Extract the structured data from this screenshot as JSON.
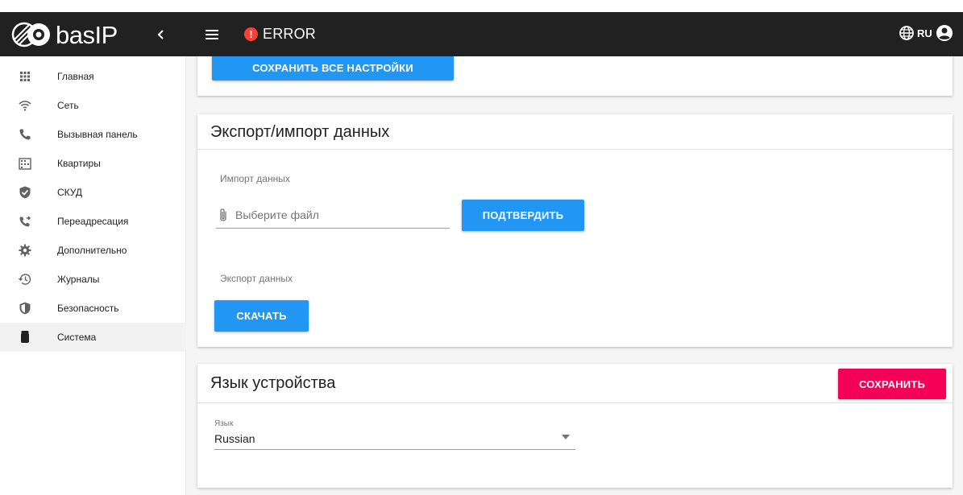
{
  "header": {
    "logo_text": "basIP",
    "status_text": "ERROR",
    "language_code": "RU",
    "error_color": "#f44336"
  },
  "sidebar": {
    "items": [
      {
        "label": "Главная",
        "icon": "apps-grid-icon"
      },
      {
        "label": "Сеть",
        "icon": "wifi-icon"
      },
      {
        "label": "Вызывная панель",
        "icon": "phone-icon"
      },
      {
        "label": "Квартиры",
        "icon": "building-icon"
      },
      {
        "label": "СКУД",
        "icon": "shield-check-icon"
      },
      {
        "label": "Переадресация",
        "icon": "phone-forward-icon"
      },
      {
        "label": "Дополнительно",
        "icon": "gear-icon"
      },
      {
        "label": "Журналы",
        "icon": "history-icon"
      },
      {
        "label": "Безопасность",
        "icon": "security-shield-icon"
      },
      {
        "label": "Система",
        "icon": "device-icon",
        "active": true
      }
    ]
  },
  "main": {
    "save_all_label": "СОХРАНИТЬ ВСЕ НАСТРОЙКИ",
    "export_import": {
      "title": "Экспорт/импорт данных",
      "import_label": "Импорт данных",
      "file_placeholder": "Выберите файл",
      "confirm_label": "ПОДТВЕРДИТЬ",
      "export_label": "Экспорт данных",
      "download_label": "СКАЧАТЬ"
    },
    "device_language": {
      "title": "Язык устройства",
      "save_label": "СОХРАНИТЬ",
      "field_label": "Язык",
      "selected_value": "Russian"
    }
  },
  "colors": {
    "topbar": "#212121",
    "primary": "#2196f3",
    "accent": "#f50057"
  }
}
